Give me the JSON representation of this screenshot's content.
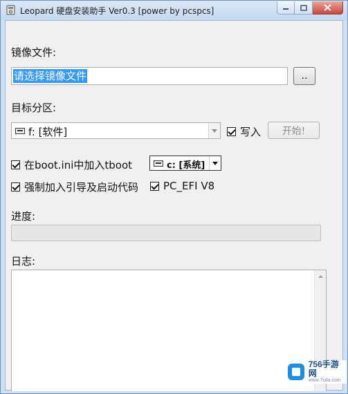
{
  "window": {
    "title": "Leopard 硬盘安装助手 Ver0.3 [power by pcspcs]"
  },
  "image_file": {
    "label": "镜像文件:",
    "value": "请选择镜像文件",
    "browse_label": ".."
  },
  "target_partition": {
    "label": "目标分区:",
    "selected": "f: [软件]",
    "write_checkbox_label": "写入",
    "write_checked": true,
    "start_label": "开始!"
  },
  "options": {
    "tboot_label": "在boot.ini中加入tboot",
    "tboot_checked": true,
    "tboot_drive": "c: [系统]",
    "force_boot_label": "强制加入引导及启动代码",
    "force_boot_checked": true,
    "pc_efi_label": "PC_EFI V8",
    "pc_efi_checked": true
  },
  "progress": {
    "label": "进度:",
    "value": 0
  },
  "log": {
    "label": "日志:"
  },
  "watermark": {
    "main": "756手游网",
    "sub": "www.7sda.com"
  }
}
